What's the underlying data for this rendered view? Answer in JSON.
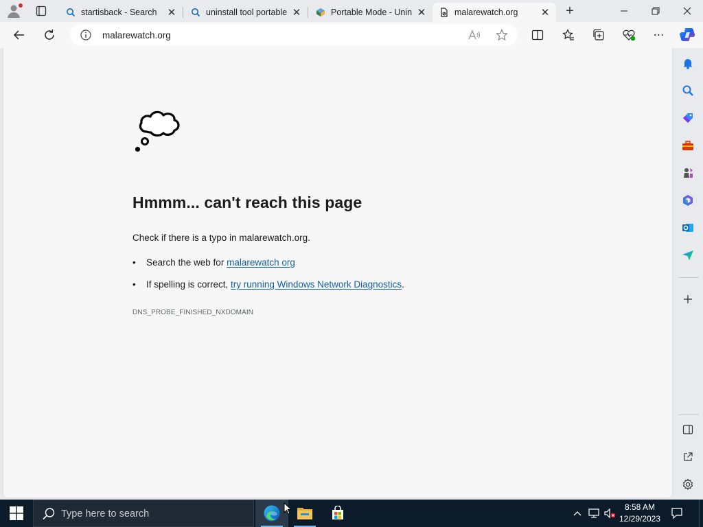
{
  "browser": {
    "tabs": [
      {
        "label": "startisback - Search",
        "icon": "search-icon"
      },
      {
        "label": "uninstall tool portable",
        "icon": "search-icon"
      },
      {
        "label": "Portable Mode - Unin",
        "icon": "site-favicon"
      },
      {
        "label": "malarewatch.org",
        "icon": "page-error-icon",
        "active": true
      }
    ],
    "address": "malarewatch.org",
    "accent_color": "#0f6cbd"
  },
  "page": {
    "title": "Hmmm... can't reach this page",
    "check_prefix": "Check if there is a typo in ",
    "check_domain": "malarewatch.org",
    "check_suffix": ".",
    "bullets": [
      {
        "prefix": "Search the web for ",
        "link": "malarewatch org",
        "suffix": ""
      },
      {
        "prefix": "If spelling is correct, ",
        "link": "try running Windows Network Diagnostics",
        "suffix": "."
      }
    ],
    "error_code": "DNS_PROBE_FINISHED_NXDOMAIN",
    "link_color": "#115ea3"
  },
  "sidebar": {
    "icons": [
      "bell-icon",
      "search-icon",
      "shopping-tag-icon",
      "toolbox-icon",
      "games-icon",
      "microsoft365-icon",
      "outlook-icon",
      "send-icon",
      "add-icon",
      "split-screen-icon",
      "open-external-icon",
      "settings-icon"
    ]
  },
  "taskbar": {
    "search_placeholder": "Type here to search",
    "time": "8:58 AM",
    "date": "12/29/2023",
    "apps": [
      "edge-icon",
      "file-explorer-icon",
      "store-icon"
    ]
  }
}
